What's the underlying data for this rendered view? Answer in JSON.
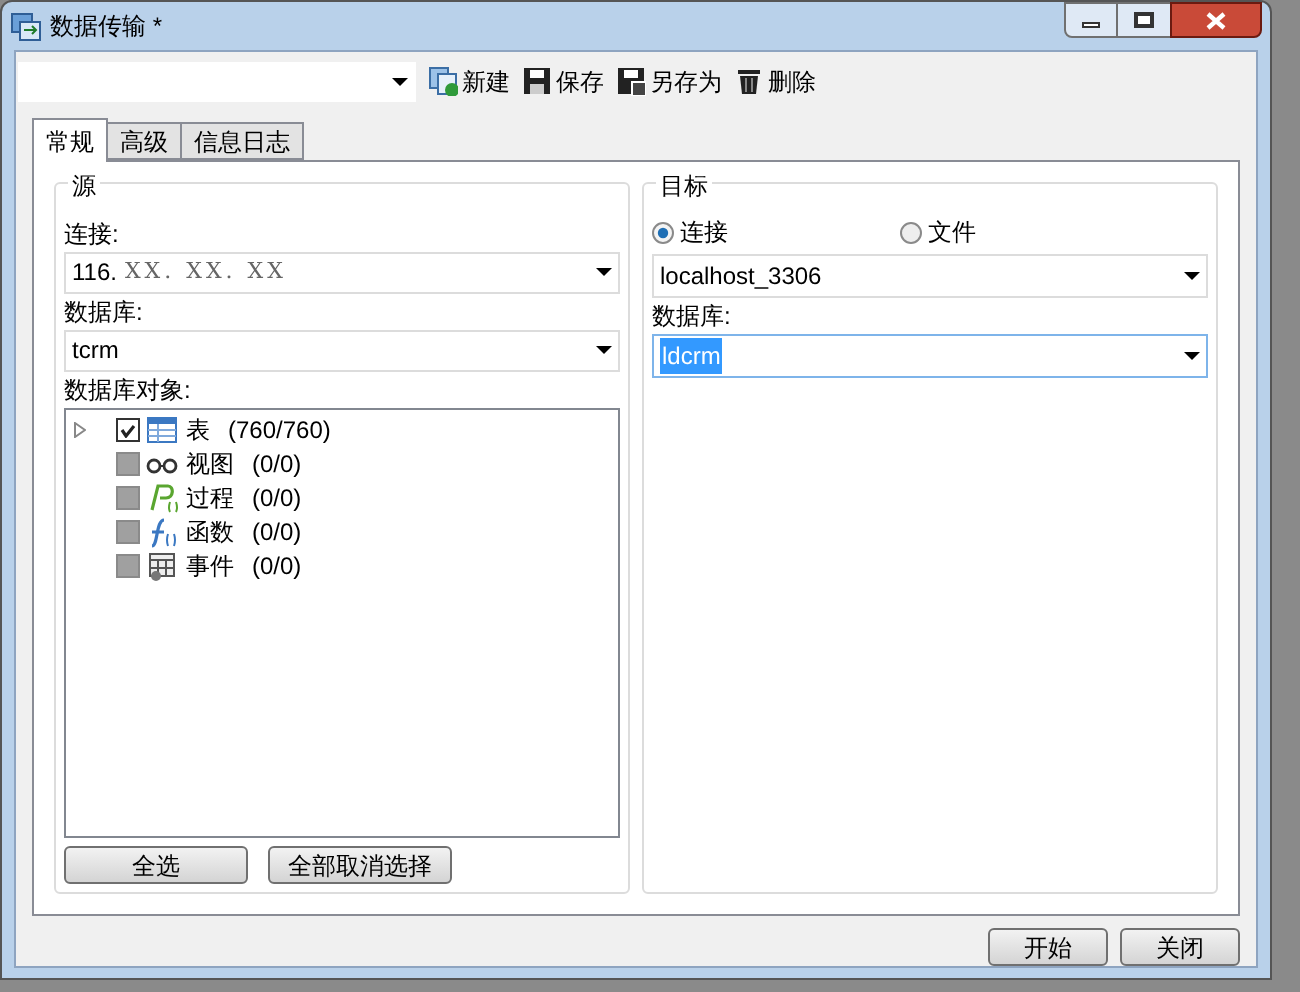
{
  "window": {
    "title": "数据传输 *"
  },
  "toolbar": {
    "buttons": [
      {
        "kind": "new",
        "label": "新建"
      },
      {
        "kind": "save",
        "label": "保存"
      },
      {
        "kind": "saveas",
        "label": "另存为"
      },
      {
        "kind": "delete",
        "label": "删除"
      }
    ]
  },
  "tabs": [
    {
      "label": "常规",
      "selected": true
    },
    {
      "label": "高级",
      "selected": false
    },
    {
      "label": "信息日志",
      "selected": false
    }
  ],
  "source": {
    "title": "源",
    "connection_label": "连接:",
    "connection": "116.",
    "connection_masked": "XX. XX. XX",
    "database_label": "数据库:",
    "database": "tcrm",
    "objects_label": "数据库对象:",
    "objects": [
      {
        "kind": "table",
        "label": "表",
        "count": "(760/760)",
        "checked": true
      },
      {
        "kind": "view",
        "label": "视图",
        "count": "(0/0)",
        "checked": false
      },
      {
        "kind": "procedure",
        "label": "过程",
        "count": "(0/0)",
        "checked": false
      },
      {
        "kind": "function",
        "label": "函数",
        "count": "(0/0)",
        "checked": false
      },
      {
        "kind": "event",
        "label": "事件",
        "count": "(0/0)",
        "checked": false
      }
    ],
    "buttons": [
      "全选",
      "全部取消选择"
    ]
  },
  "target": {
    "title": "目标",
    "options": [
      {
        "label": "连接",
        "selected": true
      },
      {
        "label": "文件",
        "selected": false
      }
    ],
    "connection": "localhost_3306",
    "database_label": "数据库:",
    "database": "ldcrm"
  },
  "footer_buttons": [
    "开始",
    "关闭"
  ]
}
